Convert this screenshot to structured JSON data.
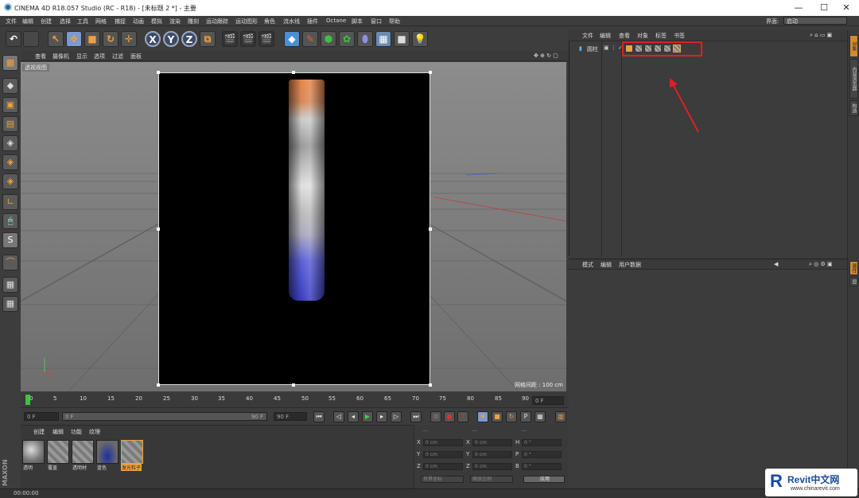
{
  "window": {
    "title": "CINEMA 4D R18.057 Studio (RC - R18) - [未标题 2 *] - 主要",
    "min": "—",
    "max": "☐",
    "close": "✕"
  },
  "menu": [
    "文件",
    "编辑",
    "创建",
    "选择",
    "工具",
    "网格",
    "捕捉",
    "动画",
    "模拟",
    "渲染",
    "雕刻",
    "运动跟踪",
    "运动图形",
    "角色",
    "流水线",
    "插件",
    "Octane",
    "脚本",
    "窗口",
    "帮助"
  ],
  "layout": {
    "label": "界面:",
    "value": "启动"
  },
  "viewport": {
    "menu": [
      "查看",
      "摄像机",
      "显示",
      "选项",
      "过滤",
      "面板"
    ],
    "label": "透视视图",
    "grid_spacing": "网格间距 : 100 cm"
  },
  "timeline": {
    "ticks": [
      "0",
      "5",
      "10",
      "15",
      "20",
      "25",
      "30",
      "35",
      "40",
      "45",
      "50",
      "55",
      "60",
      "65",
      "70",
      "75",
      "80",
      "85",
      "90"
    ],
    "frame": "0 F"
  },
  "playbar": {
    "start": "0 F",
    "current": "0 F",
    "end_inner": "90 F",
    "end": "90 F"
  },
  "material": {
    "menu": [
      "创建",
      "编辑",
      "功能",
      "纹理"
    ],
    "items": [
      "透明",
      "覆盖",
      "透明材",
      "蓝色",
      "发光粒子"
    ]
  },
  "coords": {
    "headers": [
      "—",
      "—",
      "—"
    ],
    "rows": [
      [
        "X",
        "0 cm",
        "X",
        "0 cm",
        "H",
        "0 °"
      ],
      [
        "Y",
        "0 cm",
        "Y",
        "0 cm",
        "P",
        "0 °"
      ],
      [
        "Z",
        "0 cm",
        "Z",
        "0 cm",
        "B",
        "0 °"
      ]
    ],
    "mode1": "世界坐标",
    "mode2": "缩放比例",
    "apply": "应用"
  },
  "objects": {
    "menu": [
      "文件",
      "编辑",
      "查看",
      "对象",
      "标签",
      "书签"
    ],
    "item": "圆柱"
  },
  "attributes": {
    "menu": [
      "模式",
      "编辑",
      "用户数据"
    ]
  },
  "right_tabs": [
    "对象",
    "内容浏览器",
    "构造"
  ],
  "right_tabs2": [
    "属性",
    "层"
  ],
  "status": "00:00:00",
  "watermark": {
    "brand": "Revit中文网",
    "url": "www.chinarevit.com"
  },
  "accent": "#e02020"
}
